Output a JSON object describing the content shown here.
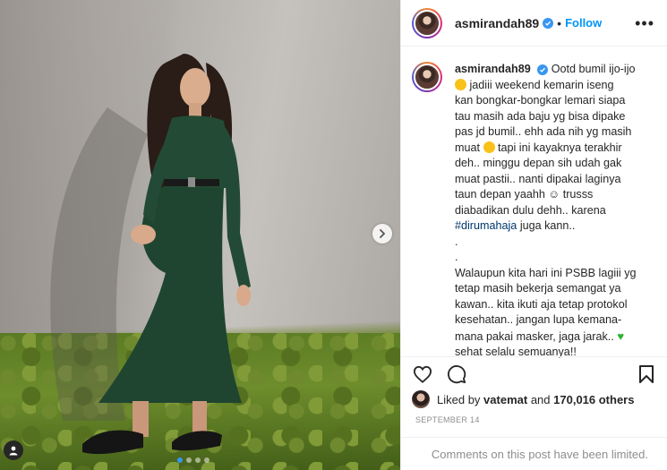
{
  "post": {
    "username": "asmirandah89",
    "follow_label": "Follow",
    "separator": "•",
    "more_label": "•••"
  },
  "caption": {
    "username": "asmirandah89",
    "lines": [
      "Ootd bumil ijo-ijo",
      "jadiii weekend kemarin iseng",
      "kan bongkar-bongkar lemari siapa",
      "tau masih ada baju yg bisa dipake",
      "pas jd bumil.. ehh ada nih yg masih",
      "muat",
      "tapi ini kayaknya terakhir",
      "deh.. minggu depan sih udah gak",
      "muat pastii.. nanti dipakai laginya",
      "taun depan yaahh ☺ trusss",
      "diabadikan dulu dehh.. karena",
      "#dirumahaja",
      "juga kann..",
      ".",
      ".",
      "Walaupun kita hari ini PSBB lagiii yg",
      "tetap masih bekerja semangat ya",
      "kawan.. kita ikuti aja tetap protokol",
      "kesehatan.. jangan lupa kemana-",
      "mana pakai masker, jaga jarak..",
      "sehat selalu semuanya!!"
    ]
  },
  "likes": {
    "prefix": "Liked by",
    "user": "vatemat",
    "and": "and",
    "count": "170,016 others"
  },
  "date": "SEPTEMBER 14",
  "comments_limited": "Comments on this post have been limited.",
  "carousel": {
    "total": 4,
    "active": 0
  },
  "icons": {
    "like": "heart-icon",
    "comment": "comment-icon",
    "save": "bookmark-icon",
    "next": "chevron-right-icon",
    "verified": "verified-badge-icon",
    "tag": "user-tag-icon"
  },
  "colors": {
    "accent": "#0095f6",
    "verified": "#3897f0",
    "hashtag": "#00376b",
    "muted": "#8e8e8e"
  }
}
